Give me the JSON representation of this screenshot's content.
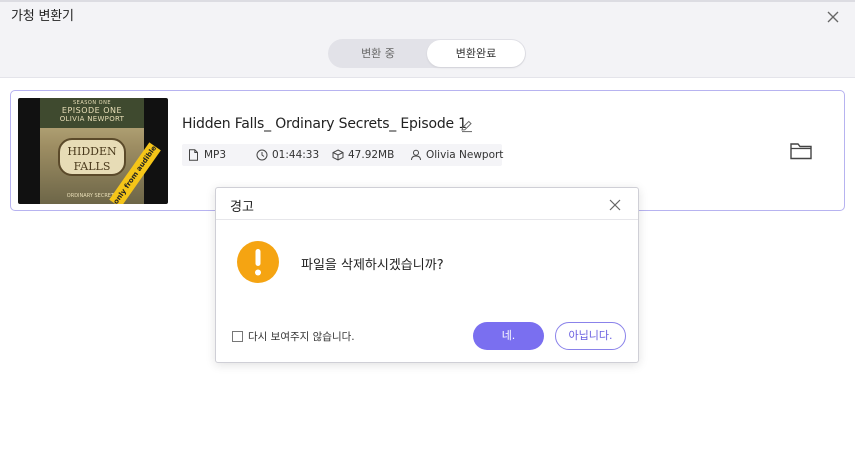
{
  "app": {
    "title": "가청 변환기",
    "close_icon": "close-icon"
  },
  "tabs": [
    {
      "label": "변환 중",
      "active": false
    },
    {
      "label": "변환완료",
      "active": true
    }
  ],
  "file": {
    "title": "Hidden Falls_ Ordinary Secrets_ Episode 1",
    "format": "MP3",
    "duration": "01:44:33",
    "size": "47.92MB",
    "author": "Olivia Newport",
    "cover": {
      "season": "SEASON ONE",
      "episode": "EPISODE ONE",
      "author": "OLIVIA NEWPORT",
      "title_line1": "HIDDEN",
      "title_line2": "FALLS",
      "subtitle": "ORDINARY SECRETS",
      "badge": "only from audible"
    }
  },
  "dialog": {
    "title": "경고",
    "message": "파일을 삭제하시겠습니까?",
    "checkbox_label": "다시 보여주지 않습니다.",
    "checkbox_checked": false,
    "yes_label": "네.",
    "no_label": "아닙니다."
  },
  "colors": {
    "accent": "#7a6ff0",
    "warning": "#f5a412",
    "card_border": "#b7b3f0"
  }
}
